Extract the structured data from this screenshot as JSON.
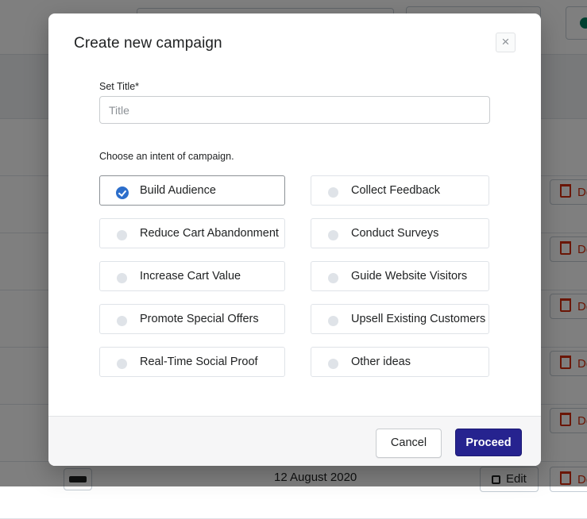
{
  "modal": {
    "title": "Create new campaign",
    "close_label": "×",
    "title_field": {
      "label": "Set Title*",
      "placeholder": "Title",
      "value": ""
    },
    "intent_label": "Choose an intent of campaign.",
    "options": [
      {
        "label": "Build Audience",
        "selected": true
      },
      {
        "label": "Collect Feedback",
        "selected": false
      },
      {
        "label": "Reduce Cart Abandonment",
        "selected": false
      },
      {
        "label": "Conduct Surveys",
        "selected": false
      },
      {
        "label": "Increase Cart Value",
        "selected": false
      },
      {
        "label": "Guide Website Visitors",
        "selected": false
      },
      {
        "label": "Promote Special Offers",
        "selected": false
      },
      {
        "label": "Upsell Existing Customers",
        "selected": false
      },
      {
        "label": "Real-Time Social Proof",
        "selected": false
      },
      {
        "label": "Other ideas",
        "selected": false
      }
    ],
    "footer": {
      "cancel_label": "Cancel",
      "proceed_label": "Proceed"
    }
  },
  "background": {
    "delete_label": "De",
    "date": "12 August 2020",
    "edit_label": "Edit"
  },
  "colors": {
    "primary": "#26238f",
    "selected_radio": "#2c6ecb",
    "danger": "#d72c0d"
  }
}
